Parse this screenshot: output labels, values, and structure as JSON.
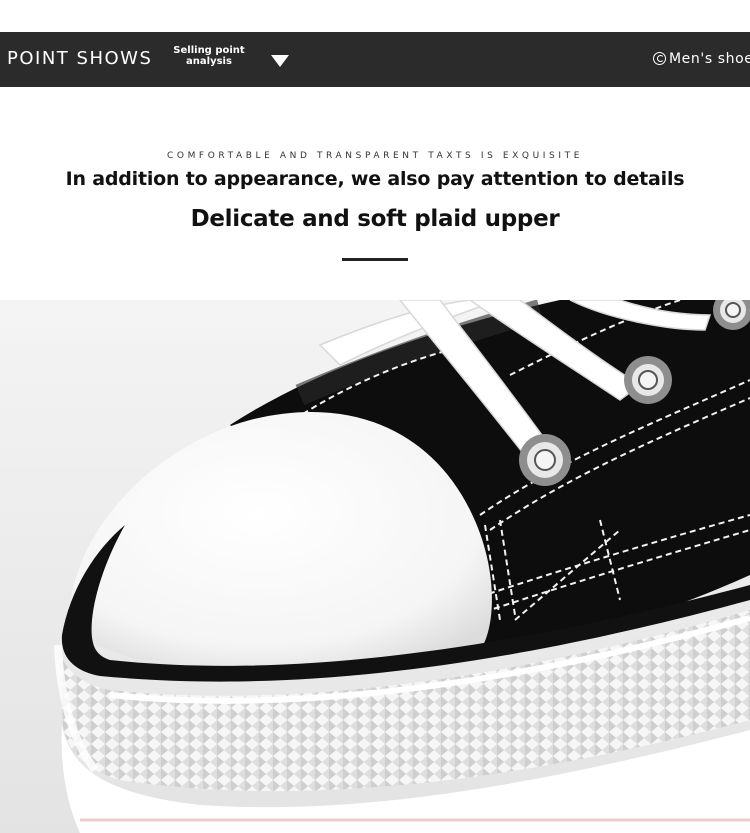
{
  "header": {
    "title": "POINT SHOWS",
    "selling_line1": "Selling point",
    "selling_line2": "analysis",
    "category": "Men's shoe"
  },
  "intro": {
    "eyebrow": "COMFORTABLE AND TRANSPARENT TAXTS IS EXQUISITE",
    "headline": "In addition to appearance, we also pay attention to details",
    "subhead": "Delicate and soft plaid upper"
  },
  "colors": {
    "bar": "#2b2b2b",
    "canvas": "#000000",
    "rubber": "#ffffff"
  },
  "icons": [
    "chevron-down-icon",
    "copyright-icon"
  ]
}
